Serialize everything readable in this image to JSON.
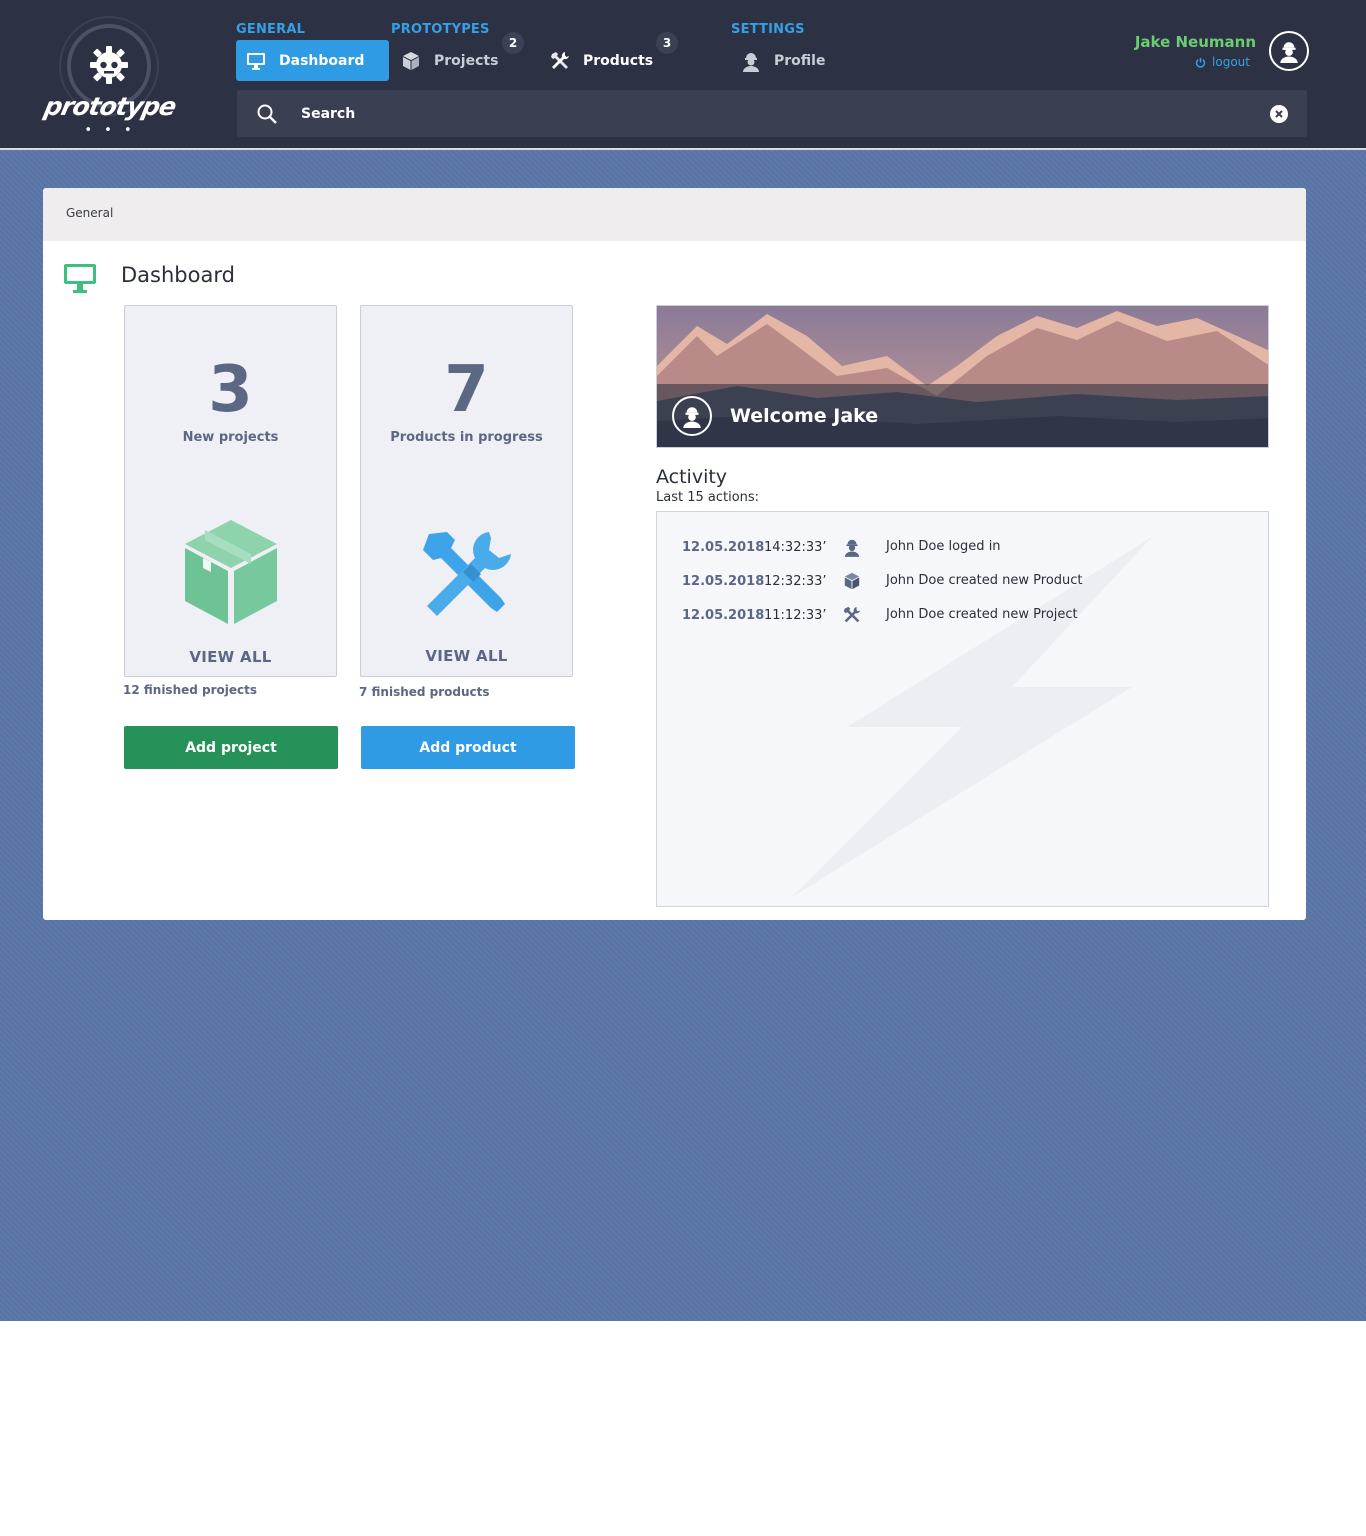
{
  "header": {
    "logo_text": "prototype",
    "logo_dots": "• • •",
    "nav_groups": {
      "general": "GENERAL",
      "prototypes": "PROTOTYPES",
      "settings": "SETTINGS"
    },
    "nav_items": {
      "dashboard": {
        "label": "Dashboard",
        "icon": "monitor-icon",
        "active": true
      },
      "projects": {
        "label": "Projects",
        "icon": "box-icon",
        "badge": "2"
      },
      "products": {
        "label": "Products",
        "icon": "tools-icon",
        "badge": "3"
      },
      "profile": {
        "label": "Profile",
        "icon": "worker-icon"
      }
    },
    "user": {
      "name": "Jake Neumann",
      "logout_label": "logout"
    },
    "search": {
      "placeholder": "Search"
    }
  },
  "breadcrumb": "General",
  "page_title": "Dashboard",
  "stats": {
    "projects": {
      "count": "3",
      "label": "New projects",
      "view_all": "VIEW ALL",
      "finished": "12 finished projects",
      "button": "Add project"
    },
    "products": {
      "count": "7",
      "label": "Products in progress",
      "view_all": "VIEW ALL",
      "finished": "7 finished products",
      "button": "Add product"
    }
  },
  "banner": {
    "welcome": "Welcome Jake"
  },
  "activity": {
    "title": "Activity",
    "subtitle": "Last 15 actions:",
    "items": [
      {
        "date": "12.05.2018",
        "time": "14:32:33’",
        "icon": "worker-icon",
        "text": "John Doe loged in"
      },
      {
        "date": "12.05.2018",
        "time": "12:32:33’",
        "icon": "box-icon",
        "text": "John Doe created new Product"
      },
      {
        "date": "12.05.2018",
        "time": "11:12:33’",
        "icon": "tools-icon",
        "text": "John Doe created new Project"
      }
    ]
  },
  "colors": {
    "header_bg": "#2c3143",
    "accent_blue": "#2e9be4",
    "accent_green": "#26925a",
    "user_green": "#6ccc73",
    "page_bg": "#5a76a8",
    "stat_text": "#5c6784"
  }
}
